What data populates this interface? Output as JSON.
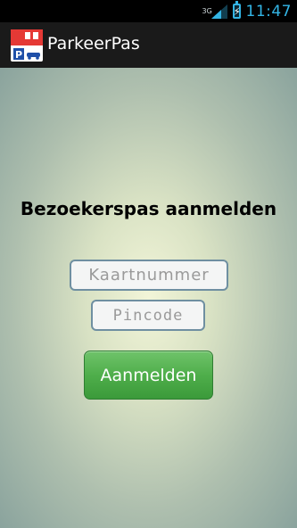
{
  "statusbar": {
    "network": "3G",
    "time": "11:47",
    "signal_icon": "signal-icon",
    "battery_icon": "battery-charging-icon"
  },
  "actionbar": {
    "title": "ParkeerPas",
    "icon": "parking-pass-app-icon"
  },
  "form": {
    "heading": "Bezoekerspas aanmelden",
    "card_placeholder": "Kaartnummer",
    "card_value": "",
    "pin_placeholder": "Pincode",
    "pin_value": "",
    "submit_label": "Aanmelden"
  },
  "colors": {
    "accent_blue": "#33b5e5",
    "button_green": "#4fae4b",
    "input_border": "#6f8fa1"
  }
}
